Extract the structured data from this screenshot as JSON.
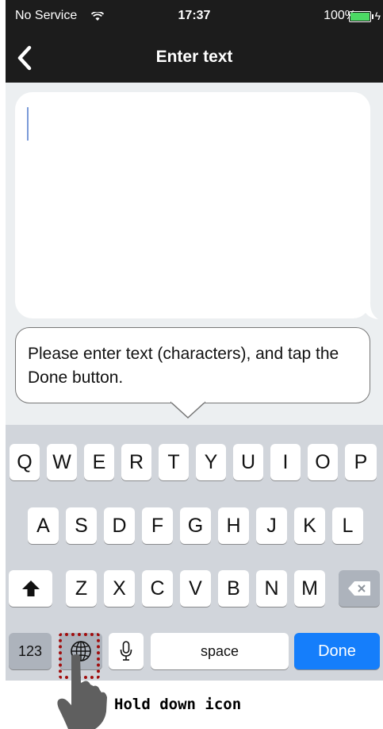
{
  "status_bar": {
    "carrier": "No Service",
    "time": "17:37",
    "battery": "100%"
  },
  "navbar": {
    "title": "Enter text"
  },
  "tooltip": {
    "text": "Please enter text (characters), and tap the Done button."
  },
  "keyboard": {
    "row1": [
      "Q",
      "W",
      "E",
      "R",
      "T",
      "Y",
      "U",
      "I",
      "O",
      "P"
    ],
    "row2": [
      "A",
      "S",
      "D",
      "F",
      "G",
      "H",
      "J",
      "K",
      "L"
    ],
    "row3": [
      "Z",
      "X",
      "C",
      "V",
      "B",
      "N",
      "M"
    ],
    "numbers_label": "123",
    "space_label": "space",
    "done_label": "Done"
  },
  "annotation": {
    "caption": "Hold down icon"
  },
  "colors": {
    "done": "#157efb",
    "highlight": "#a10d0d"
  }
}
